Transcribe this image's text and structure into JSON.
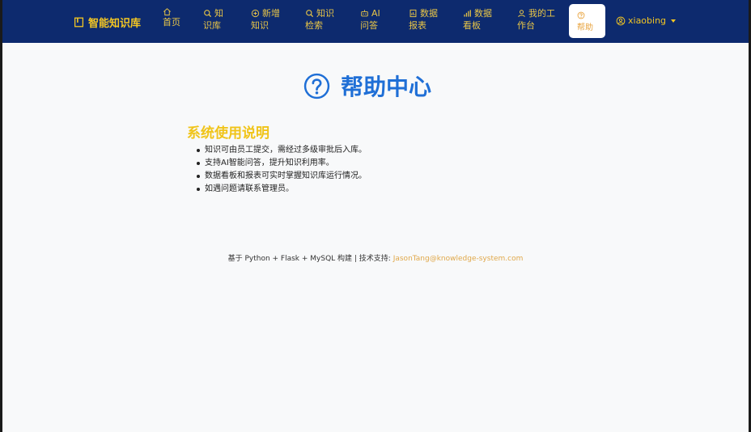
{
  "brand": {
    "title": "智能知识库",
    "icon": "book-icon"
  },
  "nav": {
    "items": [
      {
        "line1": "首页",
        "line2": "",
        "icon": "home-icon",
        "color": "#e8c547"
      },
      {
        "line1": "知",
        "line2": "识库",
        "icon": "search-icon"
      },
      {
        "line1": "新增",
        "line2": "知识",
        "icon": "plus-circle-icon"
      },
      {
        "line1": "知识",
        "line2": "检索",
        "icon": "search-icon"
      },
      {
        "line1": "AI",
        "line2": "问答",
        "icon": "robot-icon"
      },
      {
        "line1": "数据",
        "line2": "报表",
        "icon": "report-icon"
      },
      {
        "line1": "数据",
        "line2": "看板",
        "icon": "bar-chart-icon"
      },
      {
        "line1": "我的工",
        "line2": "作台",
        "icon": "user-icon"
      }
    ],
    "help": {
      "line1": "帮助",
      "icon": "help-circle-icon",
      "active": true
    },
    "user": {
      "name": "xiaobing",
      "icon": "user-circle-icon"
    }
  },
  "main": {
    "title": "帮助中心",
    "title_icon": "help-circle-icon",
    "section_title": "系统使用说明",
    "bullets": [
      "知识可由员工提交，需经过多级审批后入库。",
      "支持AI智能问答，提升知识利用率。",
      "数据看板和报表可实时掌握知识库运行情况。",
      "如遇问题请联系管理员。"
    ]
  },
  "footer": {
    "text": "基于 Python + Flask + MySQL 构建 | 技术支持: ",
    "email": "JasonTang@knowledge-system.com"
  },
  "colors": {
    "navbar": "#0d2a6e",
    "nav_text": "#e8c547",
    "title_blue": "#1f6fd6",
    "section_gold": "#f0c419",
    "footer_link": "#e0a84a"
  }
}
